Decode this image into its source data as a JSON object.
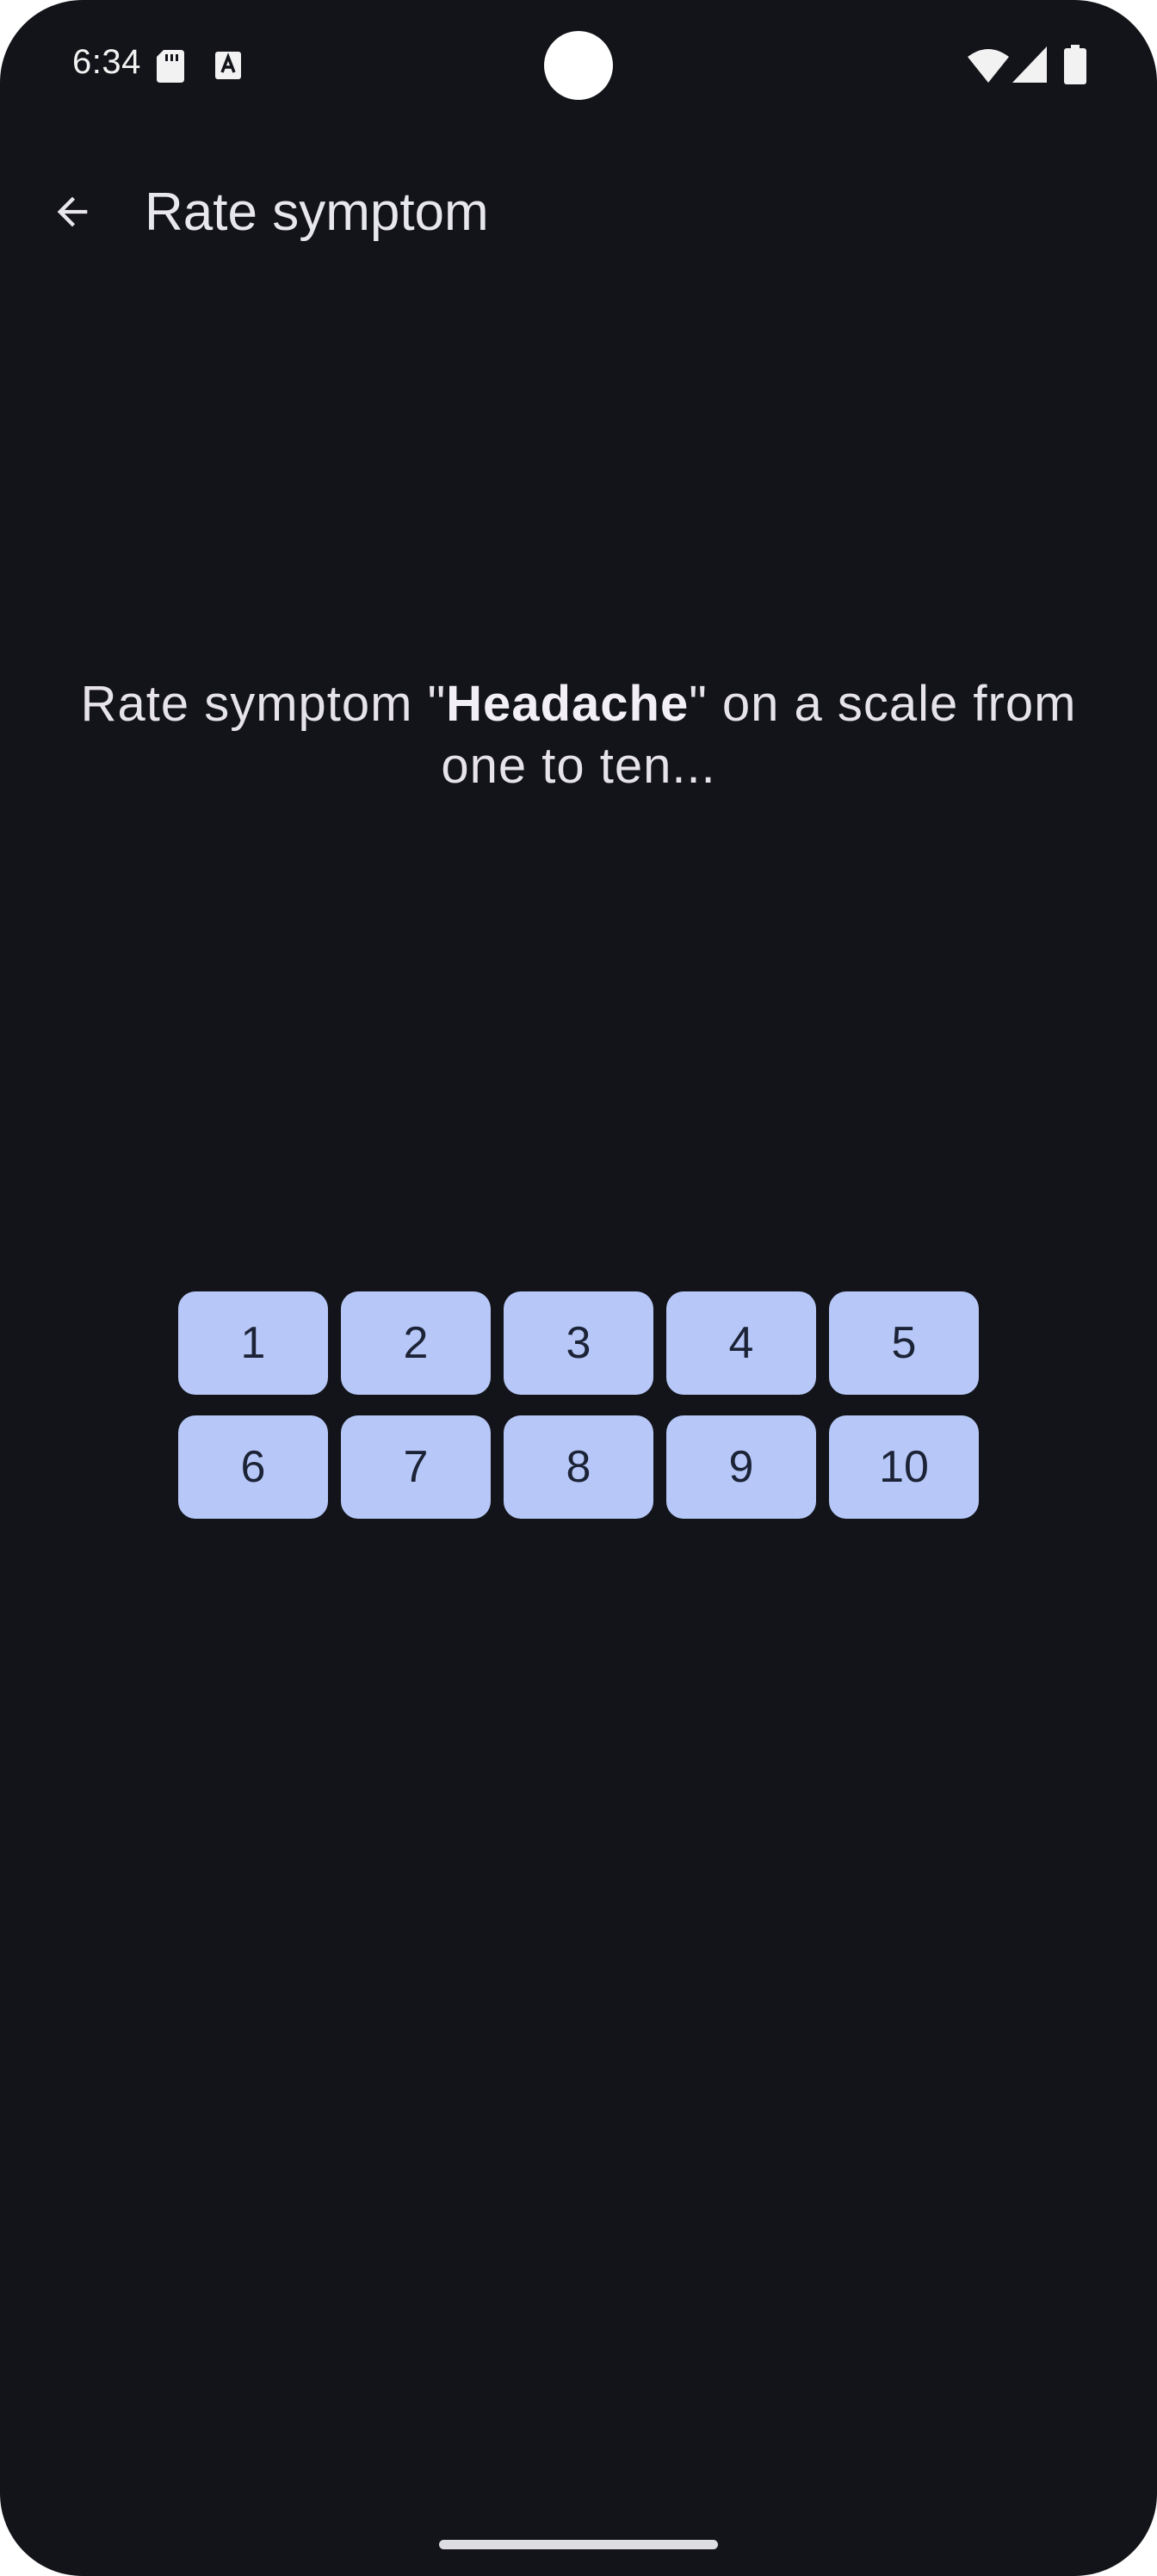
{
  "status_bar": {
    "time": "6:34",
    "icons": [
      "sd-card-icon",
      "a-text-icon",
      "wifi-icon",
      "cell-signal-icon",
      "battery-icon"
    ]
  },
  "app_bar": {
    "back_icon": "arrow-back-icon",
    "title": "Rate symptom"
  },
  "prompt": {
    "before": "Rate symptom \"",
    "symptom": "Headache",
    "after": "\" on a scale from one to ten..."
  },
  "rating_buttons": [
    "1",
    "2",
    "3",
    "4",
    "5",
    "6",
    "7",
    "8",
    "9",
    "10"
  ],
  "colors": {
    "background": "#131419",
    "button_fill": "#b7c8f8",
    "button_text": "#1c2336",
    "text": "#e6e3ea"
  }
}
